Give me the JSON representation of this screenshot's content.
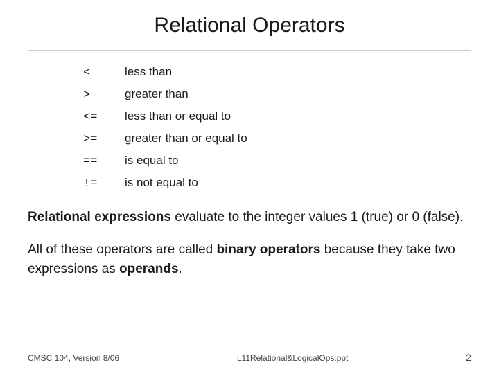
{
  "title": "Relational Operators",
  "operators": [
    {
      "symbol": "<",
      "description": "less than"
    },
    {
      "symbol": ">",
      "description": "greater than"
    },
    {
      "symbol": "<=",
      "description": "less than or equal to"
    },
    {
      "symbol": ">=",
      "description": "greater than or equal to"
    },
    {
      "symbol": "==",
      "description": "is equal to"
    },
    {
      "symbol": "!=",
      "description": "is not equal to"
    }
  ],
  "section1": {
    "bold_text": "Relational expressions",
    "rest_text": " evaluate to the integer values 1 (true) or 0 (false)."
  },
  "section2": {
    "text_before": "All of these operators are called ",
    "bold_text": "binary operators",
    "text_middle": " because they take two expressions as ",
    "bold_text2": "operands",
    "text_end": "."
  },
  "footer": {
    "left": "CMSC 104, Version 8/06",
    "center": "L11Relational&LogicalOps.ppt",
    "right": "2"
  }
}
